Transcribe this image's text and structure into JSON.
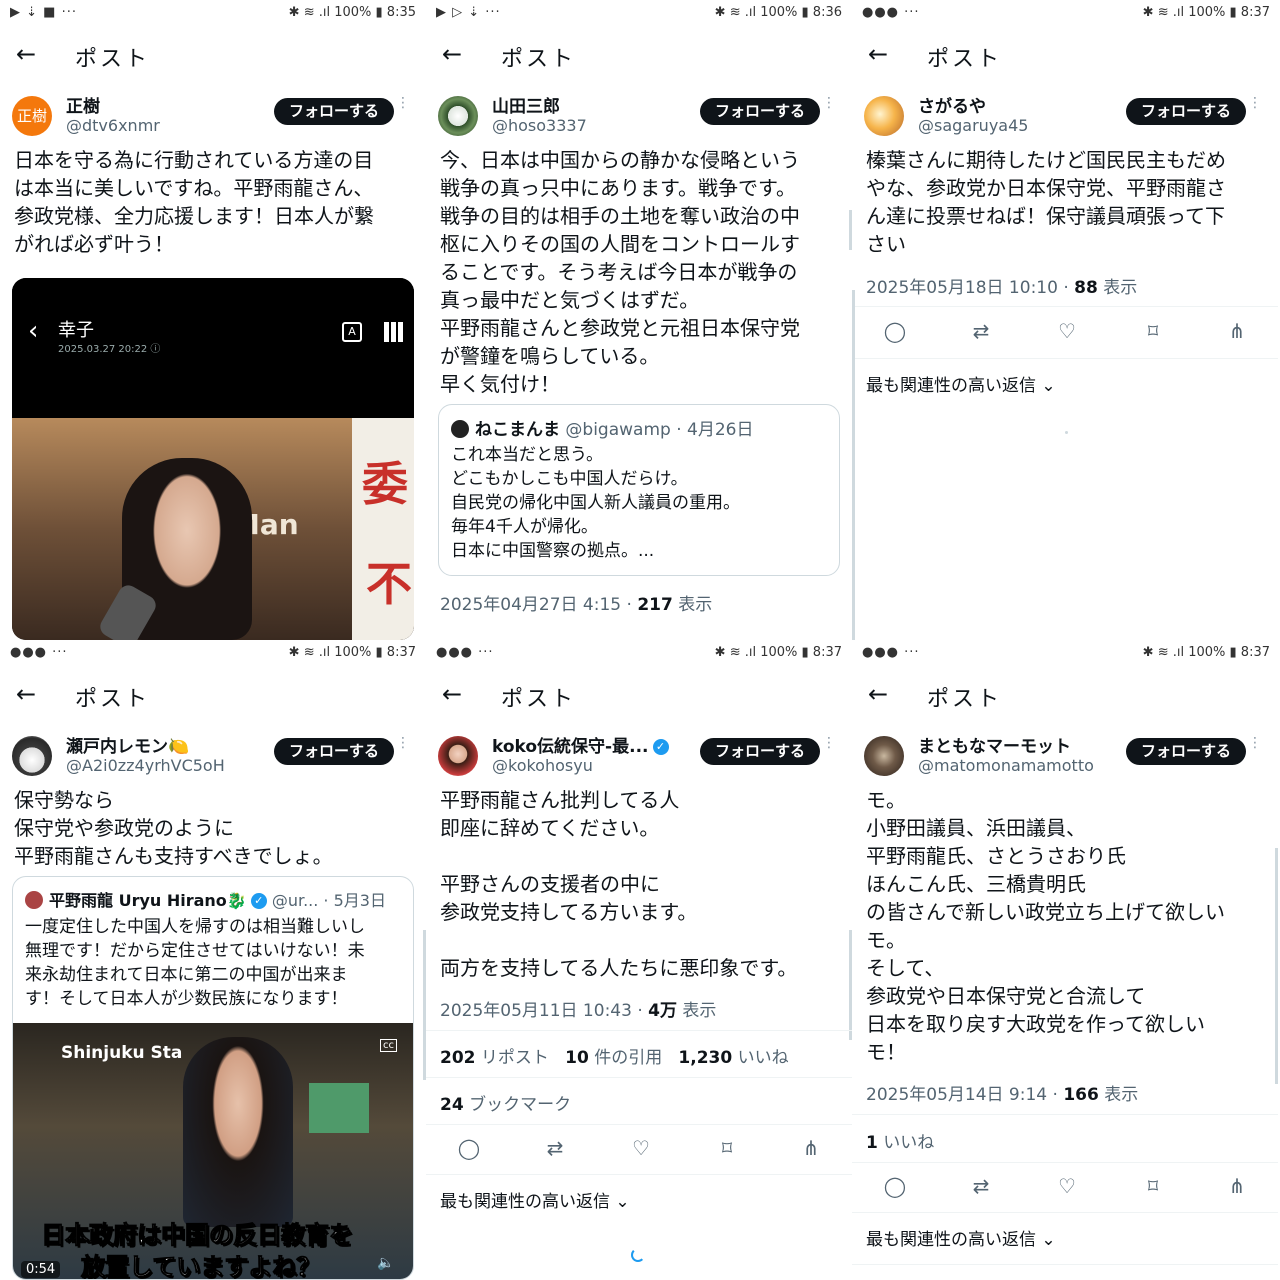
{
  "status_bars": [
    {
      "left": "▶ ⇣ ■  ···",
      "right": "✱ ≋ .ıl 100% ▮ 8:35"
    },
    {
      "left": "▶ ▷ ⇣  ···",
      "right": "✱ ≋ .ıl 100% ▮ 8:36"
    },
    {
      "left": "●●●  ···",
      "right": "✱ ≋ .ıl 100% ▮ 8:37"
    },
    {
      "left": "●●●  ···",
      "right": "✱ ≋ .ıl 100% ▮ 8:37"
    },
    {
      "left": "●●●  ···",
      "right": "✱ ≋ .ıl 100% ▮ 8:37"
    },
    {
      "left": "●●●  ···",
      "right": "✱ ≋ .ıl 100% ▮ 8:37"
    }
  ],
  "nav_title": "ポスト",
  "follow_label": "フォローする",
  "reply_sort": "最も関連性の高い返信",
  "posts": [
    {
      "avatar_text": "正樹",
      "display_name": "正樹",
      "handle": "@dtv6xnmr",
      "text": "日本を守る為に行動されている方達の目\nは本当に美しいですね。平野雨龍さん、\n参政党様、全力応援します！日本人が繋\nがれば必ず叶う！",
      "media": {
        "title": "幸子",
        "date": "2025.03.27 20:22 ⓘ",
        "sign_a": "委",
        "sign_b": "不",
        "bg_text": "Man"
      }
    },
    {
      "display_name": "山田三郎",
      "handle": "@hoso3337",
      "text": "今、日本は中国からの静かな侵略という\n戦争の真っ只中にあります。戦争です。\n戦争の目的は相手の土地を奪い政治の中\n枢に入りその国の人間をコントロールす\nることです。そう考えば今日本が戦争の\n真っ最中だと気づくはずだ。\n平野雨龍さんと参政党と元祖日本保守党\nが警鐘を鳴らしている。\n早く気付け！",
      "quote": {
        "name": "ねこまんま",
        "handle": "@bigawamp · 4月26日",
        "text": "これ本当だと思う。\nどこもかしこも中国人だらけ。\n自民党の帰化中国人新人議員の重用。\n毎年4千人が帰化。\n日本に中国警察の拠点。..."
      },
      "date": "2025年04月27日 4:15 · ",
      "views": "217",
      "views_label": " 表示"
    },
    {
      "display_name": "さがるや",
      "handle": "@sagaruya45",
      "text": "榛葉さんに期待したけど国民民主もだめ\nやな、参政党か日本保守党、平野雨龍さ\nん達に投票せねば！保守議員頑張って下\nさい",
      "date": "2025年05月18日 10:10 · ",
      "views": "88",
      "views_label": " 表示"
    },
    {
      "display_name": "瀬戸内レモン🍋",
      "handle": "@A2i0zz4yrhVC5oH",
      "text": "保守勢なら\n保守党や参政党のように\n平野雨龍さんも支持すべきでしょ。",
      "quote": {
        "name": "平野雨龍 Uryu Hirano🐉",
        "handle": "@ur... · 5月3日",
        "text": "一度定住した中国人を帰すのは相当難しいし\n無理です！だから定住させてはいけない！未\n来永劫住まれて日本に第二の中国が出来ま\nす！そして日本人が少数民族になります！",
        "video": {
          "station": "Shinjuku Sta",
          "caption1": "日本政府は中国の反日教育を",
          "caption2": "放置していますよね？",
          "time": "0:54",
          "cc": "cc"
        }
      }
    },
    {
      "display_name": "koko伝統保守-最...",
      "handle": "@kokohosyu",
      "text": "平野雨龍さん批判してる人\n即座に辞めてください。\n\n平野さんの支援者の中に\n参政党支持してる方います。\n\n両方を支持してる人たちに悪印象です。",
      "date": "2025年05月11日 10:43 · ",
      "views": "4万",
      "views_label": " 表示",
      "reposts": "202",
      "reposts_label": " リポスト",
      "quotes": "10",
      "quotes_label": " 件の引用",
      "likes": "1,230",
      "likes_label": " いいね",
      "bookmarks": "24",
      "bookmarks_label": " ブックマーク"
    },
    {
      "display_name": "まともなマーモット",
      "handle": "@matomonamamotto",
      "text": "モ。\n小野田議員、浜田議員、\n平野雨龍氏、さとうさおり氏\nほんこん氏、三橋貴明氏\nの皆さんで新しい政党立ち上げて欲しい\nモ。\nそして、\n参政党や日本保守党と合流して\n日本を取り戻す大政党を作って欲しい\nモ！",
      "date": "2025年05月14日 9:14 · ",
      "views": "166",
      "views_label": " 表示",
      "likes": "1",
      "likes_label": " いいね"
    }
  ],
  "icons": {
    "back": "←",
    "reply": "◯",
    "repost": "⇄",
    "like": "♡",
    "bookmark": "⌑",
    "share": "⋔",
    "more": "⋮",
    "chevron": "⌄"
  }
}
